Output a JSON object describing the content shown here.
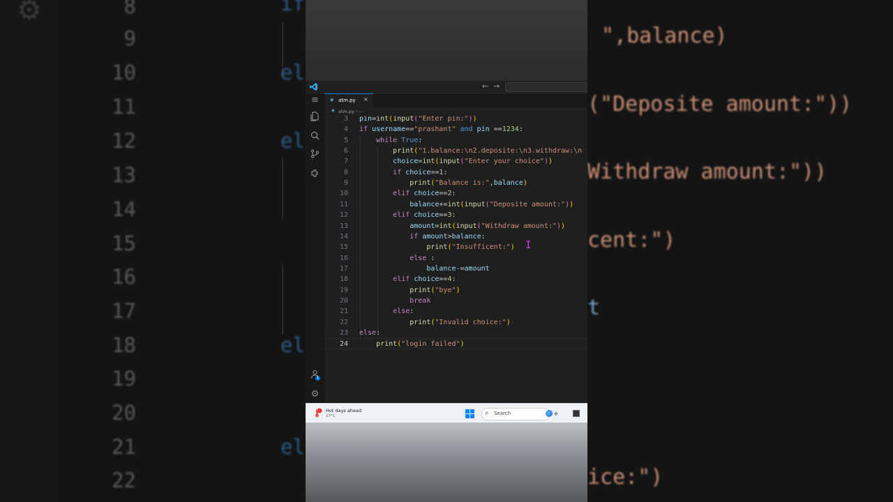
{
  "editor": {
    "tab": {
      "file_name": "atm.py",
      "close_glyph": "×"
    },
    "breadcrumb": {
      "file_name": "atm.py",
      "separator": "› ..."
    },
    "bg_line_numbers": [
      "8",
      "9",
      "10",
      "11",
      "12",
      "13",
      "14",
      "15",
      "16",
      "17",
      "18",
      "19",
      "20",
      "21",
      "22"
    ],
    "bg_code": {
      "l9": "\",balance)",
      "l11": "(\"Deposite amount:\"))",
      "l13": "Withdraw amount:\"))",
      "l15": "cent:\")",
      "l17": "t",
      "l22": "ice:\")"
    },
    "bg_keywords": {
      "k8": "if",
      "k10": "el",
      "k12": "el",
      "k18": "el",
      "k21": "el"
    },
    "lines": [
      {
        "n": "3",
        "t": [
          [
            "var",
            "pin"
          ],
          [
            "txt",
            "="
          ],
          [
            "fn",
            "int"
          ],
          [
            "p1",
            "("
          ],
          [
            "fn",
            "input"
          ],
          [
            "p2",
            "("
          ],
          [
            "str",
            "\"Enter pin:\""
          ],
          [
            "p2",
            ")"
          ],
          [
            "p1",
            ")"
          ]
        ]
      },
      {
        "n": "4",
        "t": [
          [
            "ctl",
            "if "
          ],
          [
            "var",
            "username"
          ],
          [
            "txt",
            "=="
          ],
          [
            "str",
            "\"prashant\""
          ],
          [
            "kw",
            " and "
          ],
          [
            "var",
            "pin "
          ],
          [
            "txt",
            "=="
          ],
          [
            "num",
            "1234"
          ],
          [
            "txt",
            ":"
          ]
        ]
      },
      {
        "n": "5",
        "t": [
          [
            "txt",
            "    "
          ],
          [
            "ctl",
            "while "
          ],
          [
            "kw",
            "True"
          ],
          [
            "txt",
            ":"
          ]
        ]
      },
      {
        "n": "6",
        "t": [
          [
            "txt",
            "        "
          ],
          [
            "fn",
            "print"
          ],
          [
            "p1",
            "("
          ],
          [
            "str",
            "\"1.balance:\\n2.deposite:\\n3.withdraw:\\n"
          ]
        ]
      },
      {
        "n": "7",
        "t": [
          [
            "txt",
            "        "
          ],
          [
            "var",
            "choice"
          ],
          [
            "txt",
            "="
          ],
          [
            "fn",
            "int"
          ],
          [
            "p1",
            "("
          ],
          [
            "fn",
            "input"
          ],
          [
            "p2",
            "("
          ],
          [
            "str",
            "\"Enter your choice\""
          ],
          [
            "p2",
            ")"
          ],
          [
            "p1",
            ")"
          ]
        ]
      },
      {
        "n": "8",
        "t": [
          [
            "txt",
            "        "
          ],
          [
            "ctl",
            "if "
          ],
          [
            "var",
            "choice"
          ],
          [
            "txt",
            "=="
          ],
          [
            "num",
            "1"
          ],
          [
            "txt",
            ":"
          ]
        ]
      },
      {
        "n": "9",
        "t": [
          [
            "txt",
            "            "
          ],
          [
            "fn",
            "print"
          ],
          [
            "p1",
            "("
          ],
          [
            "str",
            "\"Balance is:\""
          ],
          [
            "txt",
            ","
          ],
          [
            "var",
            "balance"
          ],
          [
            "p1",
            ")"
          ]
        ]
      },
      {
        "n": "10",
        "t": [
          [
            "txt",
            "        "
          ],
          [
            "ctl",
            "elif "
          ],
          [
            "var",
            "choice"
          ],
          [
            "txt",
            "=="
          ],
          [
            "num",
            "2"
          ],
          [
            "txt",
            ":"
          ]
        ]
      },
      {
        "n": "11",
        "t": [
          [
            "txt",
            "            "
          ],
          [
            "var",
            "balance"
          ],
          [
            "txt",
            "+="
          ],
          [
            "fn",
            "int"
          ],
          [
            "p1",
            "("
          ],
          [
            "fn",
            "input"
          ],
          [
            "p2",
            "("
          ],
          [
            "str",
            "\"Deposite amount:\""
          ],
          [
            "p2",
            ")"
          ],
          [
            "p1",
            ")"
          ]
        ]
      },
      {
        "n": "12",
        "t": [
          [
            "txt",
            "        "
          ],
          [
            "ctl",
            "elif "
          ],
          [
            "var",
            "choice"
          ],
          [
            "txt",
            "=="
          ],
          [
            "num",
            "3"
          ],
          [
            "txt",
            ":"
          ]
        ]
      },
      {
        "n": "13",
        "t": [
          [
            "txt",
            "            "
          ],
          [
            "var",
            "amount"
          ],
          [
            "txt",
            "="
          ],
          [
            "fn",
            "int"
          ],
          [
            "p1",
            "("
          ],
          [
            "fn",
            "input"
          ],
          [
            "p2",
            "("
          ],
          [
            "str",
            "\"Withdraw amount:\""
          ],
          [
            "p2",
            ")"
          ],
          [
            "p1",
            ")"
          ]
        ]
      },
      {
        "n": "14",
        "t": [
          [
            "txt",
            "            "
          ],
          [
            "ctl",
            "if "
          ],
          [
            "var",
            "amount"
          ],
          [
            "txt",
            ">"
          ],
          [
            "var",
            "balance"
          ],
          [
            "txt",
            ":"
          ]
        ]
      },
      {
        "n": "15",
        "t": [
          [
            "txt",
            "                "
          ],
          [
            "fn",
            "print"
          ],
          [
            "p1",
            "("
          ],
          [
            "str",
            "\"Insufficent:\""
          ],
          [
            "p1",
            ")"
          ]
        ]
      },
      {
        "n": "16",
        "t": [
          [
            "txt",
            "            "
          ],
          [
            "ctl",
            "else "
          ],
          [
            "txt",
            ":"
          ]
        ]
      },
      {
        "n": "17",
        "t": [
          [
            "txt",
            "                "
          ],
          [
            "var",
            "balance"
          ],
          [
            "txt",
            "-="
          ],
          [
            "var",
            "amount"
          ]
        ]
      },
      {
        "n": "18",
        "t": [
          [
            "txt",
            "        "
          ],
          [
            "ctl",
            "elif "
          ],
          [
            "var",
            "choice"
          ],
          [
            "txt",
            "=="
          ],
          [
            "num",
            "4"
          ],
          [
            "txt",
            ":"
          ]
        ]
      },
      {
        "n": "19",
        "t": [
          [
            "txt",
            "            "
          ],
          [
            "fn",
            "print"
          ],
          [
            "p1",
            "("
          ],
          [
            "str",
            "\"bye\""
          ],
          [
            "p1",
            ")"
          ]
        ]
      },
      {
        "n": "20",
        "t": [
          [
            "txt",
            "            "
          ],
          [
            "ctl",
            "break"
          ]
        ]
      },
      {
        "n": "21",
        "t": [
          [
            "txt",
            "        "
          ],
          [
            "ctl",
            "else"
          ],
          [
            "txt",
            ":"
          ]
        ]
      },
      {
        "n": "22",
        "t": [
          [
            "txt",
            "            "
          ],
          [
            "fn",
            "print"
          ],
          [
            "p1",
            "("
          ],
          [
            "str",
            "\"Invalid choice:\""
          ],
          [
            "p1",
            ")"
          ]
        ]
      },
      {
        "n": "23",
        "t": [
          [
            "ctl",
            "else"
          ],
          [
            "txt",
            ":"
          ]
        ]
      },
      {
        "n": "24",
        "t": [
          [
            "txt",
            "    "
          ],
          [
            "fn",
            "print"
          ],
          [
            "p1",
            "("
          ],
          [
            "str",
            "\"login failed\""
          ],
          [
            "p1",
            ")"
          ]
        ],
        "current": true
      }
    ]
  },
  "activity_bar": {
    "icons": [
      "menu-icon",
      "explorer-icon",
      "search-icon",
      "source-control-icon",
      "extensions-icon",
      "account-icon",
      "settings-icon"
    ],
    "account_badge": "1"
  },
  "titlebar": {
    "back_glyph": "←",
    "forward_glyph": "→"
  },
  "taskbar": {
    "weather_title": "Hot days ahead",
    "weather_temp": "27°C",
    "search_label": "Search"
  },
  "colors": {
    "editor_bg": "#1f1f1f",
    "accent": "#0078d4",
    "keyword": "#569cd6",
    "control": "#c586c0",
    "function": "#dcdcaa",
    "string": "#ce9178",
    "number": "#b5cea8",
    "variable": "#9cdcfe"
  }
}
